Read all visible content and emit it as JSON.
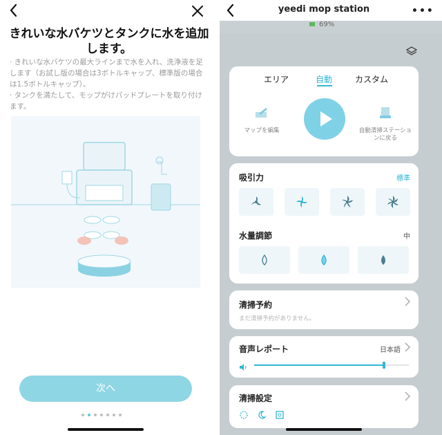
{
  "left": {
    "title": "きれいな水バケツとタンクに水を追加します。",
    "bullets": [
      "· きれいな水バケツの最大ラインまで水を入れ、洗浄液を足します（お試し版の場合は3ボトルキャップ、標準版の場合は1.5ボトルキャップ）。",
      "· タンクを満たして、モップがけパッドプレートを取り付けます。"
    ],
    "next_label": "次へ",
    "page_dots": 7,
    "active_dot": 1,
    "icons": {
      "back": "chevron-left-icon",
      "close": "close-icon"
    }
  },
  "right": {
    "title": "yeedi mop station",
    "battery": "69%",
    "modes": [
      "エリア",
      "自動",
      "カスタム"
    ],
    "active_mode": "自動",
    "edit_map": "マップを編集",
    "return_station": "自動清掃ステーションに戻る",
    "suction": {
      "title": "吸引力",
      "value": "標準"
    },
    "water": {
      "title": "水量調節",
      "value": "中"
    },
    "schedule": {
      "title": "清掃予約",
      "empty": "まだ清掃予約がありません。"
    },
    "voice": {
      "title": "音声レポート",
      "language": "日本語",
      "volume_fraction": 0.84
    },
    "settings": {
      "title": "清掃設定"
    },
    "colors": {
      "accent": "#31b7d3",
      "button": "#8fd6e4"
    }
  }
}
